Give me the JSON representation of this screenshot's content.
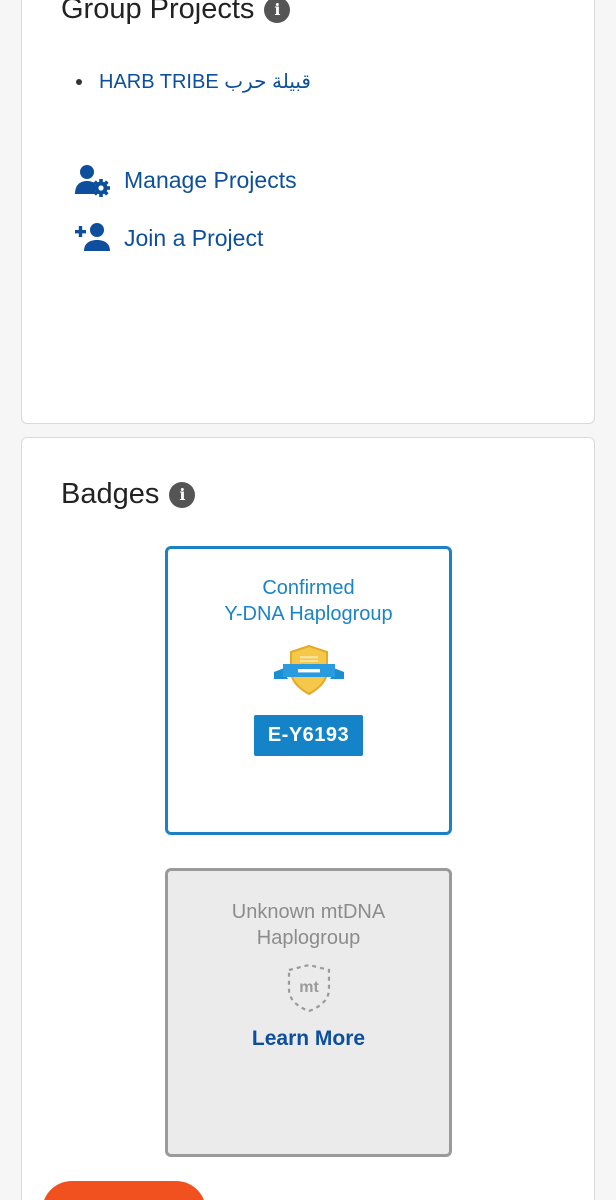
{
  "group_projects": {
    "title": "Group Projects",
    "projects": [
      "HARB TRIBE قبيلة حرب"
    ],
    "manage_label": "Manage Projects",
    "join_label": "Join a Project"
  },
  "badges": {
    "title": "Badges",
    "ydna": {
      "title_line1": "Confirmed",
      "title_line2": "Y-DNA Haplogroup",
      "haplogroup": "E-Y6193",
      "border_color": "#1c82c4"
    },
    "mtdna": {
      "title_line1": "Unknown mtDNA",
      "title_line2": "Haplogroup",
      "emblem_text": "mt",
      "link_label": "Learn More"
    }
  },
  "colors": {
    "link": "#0d4f9c",
    "accent": "#1483c7",
    "cta": "#f0511f"
  },
  "icons": {
    "info": "info-icon",
    "manage": "user-gear-icon",
    "join": "user-plus-icon",
    "ydna": "shield-ribbon-badge-icon",
    "mtdna": "dashed-shield-icon"
  }
}
